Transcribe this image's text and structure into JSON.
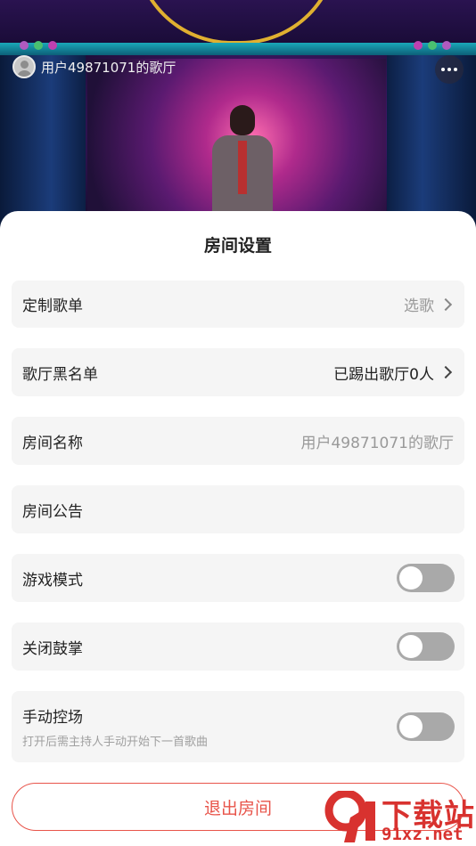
{
  "header": {
    "room_title": "用户49871071的歌厅"
  },
  "sheet": {
    "title": "房间设置",
    "rows": [
      {
        "label": "定制歌单",
        "value": "选歌",
        "has_chevron": true
      },
      {
        "label": "歌厅黑名单",
        "value": "已踢出歌厅0人",
        "has_chevron": true
      },
      {
        "label": "房间名称",
        "value": "用户49871071的歌厅"
      },
      {
        "label": "房间公告",
        "value": ""
      },
      {
        "label": "游戏模式",
        "toggle": false
      },
      {
        "label": "关闭鼓掌",
        "toggle": false
      },
      {
        "label": "手动控场",
        "sublabel": "打开后需主持人手动开始下一首歌曲",
        "toggle": false
      }
    ],
    "exit_label": "退出房间"
  },
  "watermark": {
    "text": "下载站",
    "url": "91xz.net",
    "logo_text": "9"
  },
  "colors": {
    "accent": "#e8544a",
    "row_bg": "#f5f5f5",
    "toggle_off": "#a9a9a9"
  }
}
